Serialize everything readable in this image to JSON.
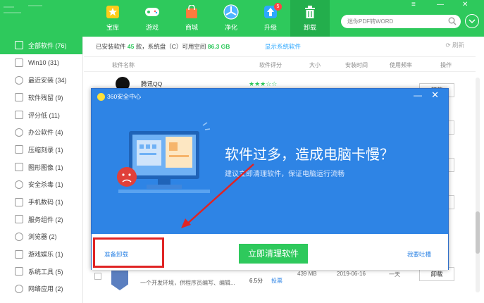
{
  "nav": [
    {
      "label": "宝库",
      "icon": "star-icon"
    },
    {
      "label": "游戏",
      "icon": "gamepad-icon"
    },
    {
      "label": "商城",
      "icon": "bag-icon"
    },
    {
      "label": "净化",
      "icon": "fan-icon"
    },
    {
      "label": "升级",
      "icon": "upload-icon",
      "badge": "5"
    },
    {
      "label": "卸载",
      "icon": "trash-icon"
    }
  ],
  "search": {
    "placeholder": "迷你PDF转WORD"
  },
  "window_controls": {
    "menu": "≡",
    "minimize": "—",
    "close": "✕"
  },
  "sidebar": [
    {
      "label": "全部软件 (76)"
    },
    {
      "label": "Win10 (31)"
    },
    {
      "label": "最近安装 (34)"
    },
    {
      "label": "软件残留 (9)"
    },
    {
      "label": "评分低 (11)"
    },
    {
      "label": "办公软件 (4)"
    },
    {
      "label": "压缩刻录 (1)"
    },
    {
      "label": "图形图像 (1)"
    },
    {
      "label": "安全杀毒 (1)"
    },
    {
      "label": "手机数码 (1)"
    },
    {
      "label": "服务组件 (2)"
    },
    {
      "label": "浏览器 (2)"
    },
    {
      "label": "游戏娱乐 (1)"
    },
    {
      "label": "系统工具 (5)"
    },
    {
      "label": "网络应用 (2)"
    }
  ],
  "info": {
    "prefix": "已安装软件",
    "count": "45",
    "mid": "款，系统盘（C）可用空间",
    "space": "86.3 GB"
  },
  "show_system": "显示系统软件",
  "refresh": "刷新",
  "columns": [
    "软件名称",
    "软件评分",
    "大小",
    "安装时间",
    "使用频率",
    "操作"
  ],
  "peek_row": {
    "name": "腾讯QQ"
  },
  "bottom_row": {
    "desc": "一个开发环境，供程序员编写、编辑...",
    "score": "6.5分",
    "vote": "投票",
    "size": "439 MB",
    "date": "2019-06-16",
    "freq": "一天"
  },
  "uninstall_label": "卸载",
  "modal": {
    "title": "360安全中心",
    "headline": "软件过多，造成电脑卡慢？",
    "subtitle": "建议立即清理软件，保证电脑运行流畅",
    "prepare": "准备卸载",
    "clean": "立即清理软件",
    "feedback": "我要吐槽"
  },
  "colors": {
    "green": "#2ec95c",
    "blue": "#2e84e5",
    "red": "#e02424"
  }
}
